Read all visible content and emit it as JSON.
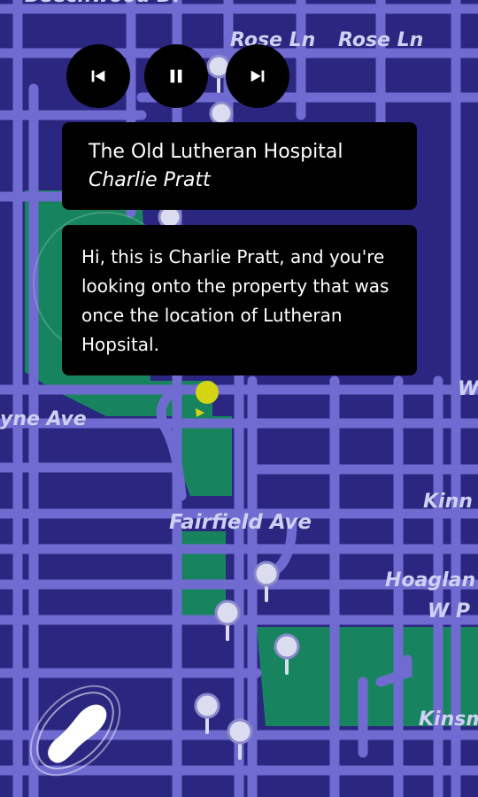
{
  "map": {
    "street_labels": {
      "beechwood": "Beechwood Dr",
      "rose_ln_1": "Rose Ln",
      "rose_ln_2": "Rose Ln",
      "wayne_ave": "yne Ave",
      "fairfield_ave": "Fairfield Ave",
      "kinn": "Kinn",
      "hoaglan": "Hoaglan",
      "w_p": "W P",
      "kinsm": "Kinsm",
      "w_edge": "W"
    },
    "colors": {
      "background": "#2b2780",
      "street": "#6f6bd0",
      "park": "#18845f",
      "label": "#cfd0f3",
      "pin": "#dcdcf0",
      "location_dot": "#d4d413"
    }
  },
  "player": {
    "icons": [
      "skip-previous-icon",
      "pause-icon",
      "skip-next-icon"
    ]
  },
  "stop": {
    "title": "The Old Lutheran Hospital",
    "narrator": "Charlie Pratt"
  },
  "transcript": {
    "text": "Hi, this is Charlie Pratt, and you're looking onto the property that was once the location of Lutheran Hopsital."
  },
  "walk_button": {
    "icon": "footprint-icon"
  }
}
